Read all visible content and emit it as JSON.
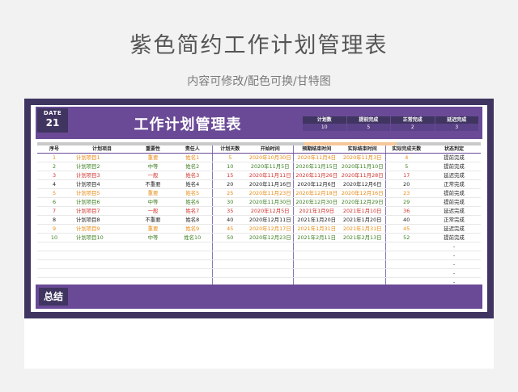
{
  "page": {
    "title": "紫色简约工作计划管理表",
    "subtitle": "内容可修改/配色可换/甘特图"
  },
  "sheet": {
    "date_label": "DATE",
    "date_value": "21",
    "title": "工作计划管理表",
    "summary_label": "总结",
    "stats": {
      "headers": [
        "计划数",
        "提前完成",
        "正常完成",
        "延迟完成"
      ],
      "values": [
        "10",
        "5",
        "2",
        "3"
      ]
    },
    "columns": [
      "序号",
      "计划项目",
      "重要性",
      "责任人",
      "计划天数",
      "开始时间",
      "预期结束时间",
      "实际结束时间",
      "实际完成天数",
      "状态判定"
    ],
    "rows": [
      {
        "no": "1",
        "item": "计划项目1",
        "importance": "重要",
        "owner": "姓名1",
        "days": "5",
        "start": "2020年10月30日",
        "expected_end": "2020年11月4日",
        "actual_end": "2020年11月3日",
        "actual_days": "4",
        "status": "提前完成",
        "color": "orange"
      },
      {
        "no": "2",
        "item": "计划项目2",
        "importance": "中等",
        "owner": "姓名2",
        "days": "10",
        "start": "2020年11月5日",
        "expected_end": "2020年11月15日",
        "actual_end": "2020年11月10日",
        "actual_days": "5",
        "status": "提前完成",
        "color": "green"
      },
      {
        "no": "3",
        "item": "计划项目3",
        "importance": "一般",
        "owner": "姓名3",
        "days": "15",
        "start": "2020年11月11日",
        "expected_end": "2020年11月26日",
        "actual_end": "2020年11月28日",
        "actual_days": "17",
        "status": "延迟完成",
        "color": "red"
      },
      {
        "no": "4",
        "item": "计划项目4",
        "importance": "不重要",
        "owner": "姓名4",
        "days": "20",
        "start": "2020年11月16日",
        "expected_end": "2020年12月6日",
        "actual_end": "2020年12月6日",
        "actual_days": "20",
        "status": "正常完成",
        "color": "default"
      },
      {
        "no": "5",
        "item": "计划项目5",
        "importance": "重要",
        "owner": "姓名5",
        "days": "25",
        "start": "2020年11月23日",
        "expected_end": "2020年12月18日",
        "actual_end": "2020年12月16日",
        "actual_days": "23",
        "status": "提前完成",
        "color": "orange"
      },
      {
        "no": "6",
        "item": "计划项目6",
        "importance": "中等",
        "owner": "姓名6",
        "days": "30",
        "start": "2020年11月30日",
        "expected_end": "2020年12月30日",
        "actual_end": "2020年12月29日",
        "actual_days": "29",
        "status": "提前完成",
        "color": "green"
      },
      {
        "no": "7",
        "item": "计划项目7",
        "importance": "一般",
        "owner": "姓名7",
        "days": "35",
        "start": "2020年12月5日",
        "expected_end": "2021年1月9日",
        "actual_end": "2021年1月10日",
        "actual_days": "36",
        "status": "延迟完成",
        "color": "red"
      },
      {
        "no": "8",
        "item": "计划项目8",
        "importance": "不重要",
        "owner": "姓名8",
        "days": "40",
        "start": "2020年12月11日",
        "expected_end": "2021年1月20日",
        "actual_end": "2021年1月20日",
        "actual_days": "40",
        "status": "正常完成",
        "color": "default"
      },
      {
        "no": "9",
        "item": "计划项目9",
        "importance": "重要",
        "owner": "姓名9",
        "days": "45",
        "start": "2020年12月17日",
        "expected_end": "2021年1月31日",
        "actual_end": "2021年1月31日",
        "actual_days": "45",
        "status": "延迟完成",
        "color": "orange"
      },
      {
        "no": "10",
        "item": "计划项目10",
        "importance": "中等",
        "owner": "姓名10",
        "days": "50",
        "start": "2020年12月23日",
        "expected_end": "2021年2月11日",
        "actual_end": "2021年2月13日",
        "actual_days": "52",
        "status": "提前完成",
        "color": "green"
      }
    ],
    "blank_rows": [
      "-",
      "-",
      "-",
      "-",
      "-"
    ]
  },
  "colors": {
    "accent_purple": "#6a4a96",
    "dark_purple": "#3f3560",
    "orange": "#e88a12",
    "green": "#3b7d1f",
    "red": "#d0302a"
  }
}
